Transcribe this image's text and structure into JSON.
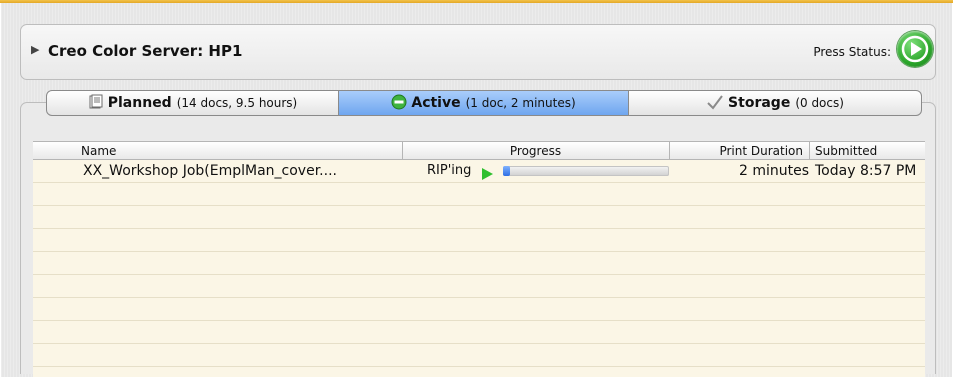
{
  "server": {
    "title": "Creo Color Server: HP1",
    "press_status_label": "Press Status:",
    "press_status_icon": "play-circle-icon",
    "accent_color": "#2aa52a"
  },
  "tabs": [
    {
      "label": "Planned",
      "meta": "(14 docs, 9.5 hours)",
      "icon": "document-icon",
      "selected": false
    },
    {
      "label": "Active",
      "meta": "(1 doc, 2 minutes)",
      "icon": "minus-circle-icon",
      "selected": true
    },
    {
      "label": "Storage",
      "meta": "(0 docs)",
      "icon": "checkmark-icon",
      "selected": false
    }
  ],
  "table": {
    "columns": {
      "name": "Name",
      "progress": "Progress",
      "print_duration": "Print Duration",
      "submitted": "Submitted"
    },
    "rows": [
      {
        "name": "XX_Workshop Job(EmplMan_cover....",
        "status": "RIP'ing",
        "progress": 0.04,
        "print_duration": "2 minutes",
        "submitted": "Today 8:57 PM"
      }
    ]
  }
}
